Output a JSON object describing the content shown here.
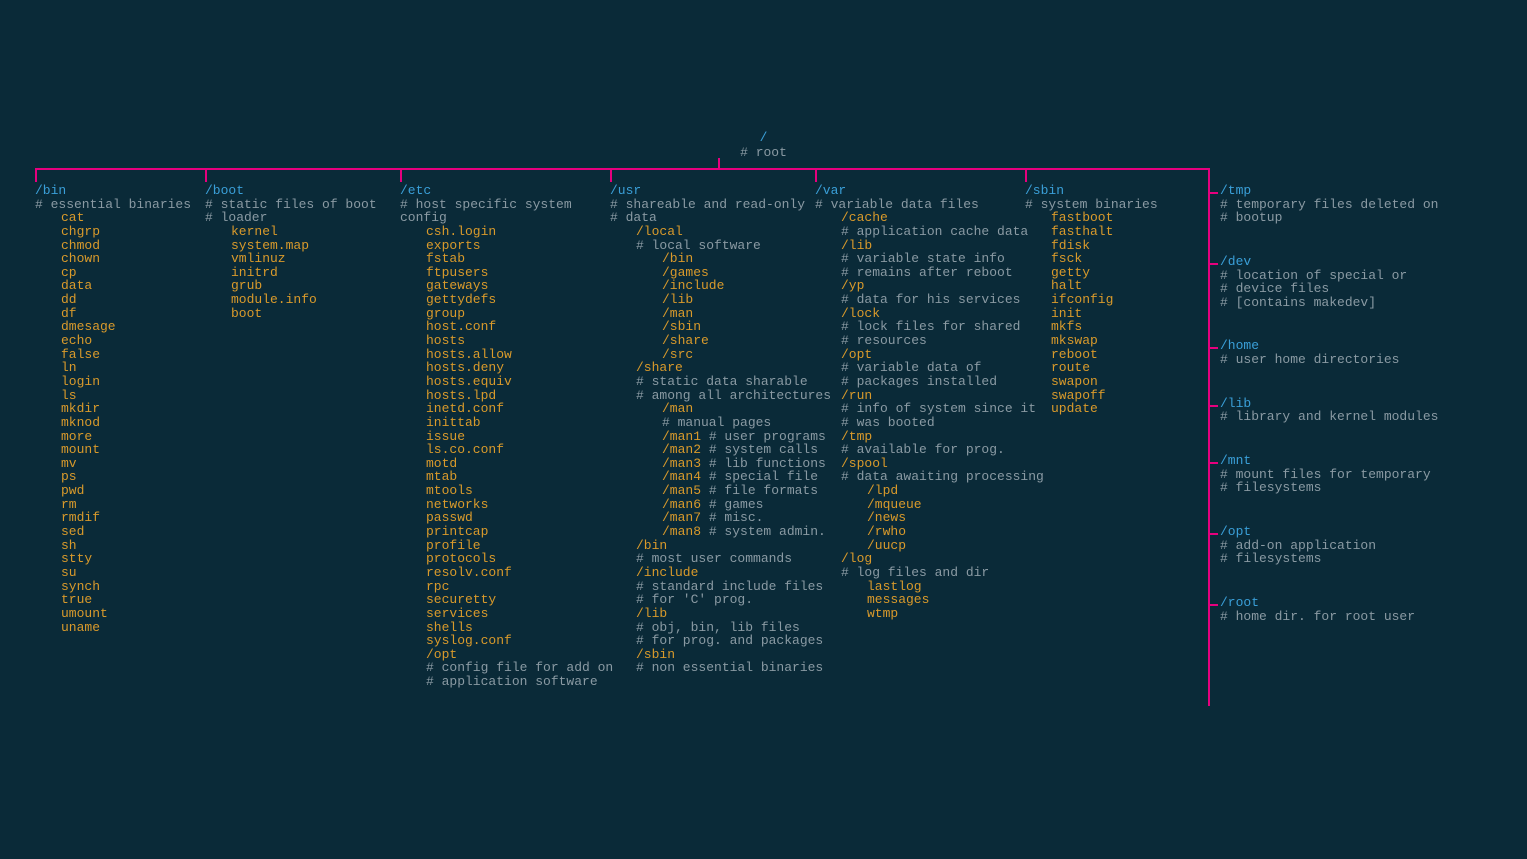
{
  "root": {
    "path": "/",
    "comment": "# root"
  },
  "layout": {
    "hbar_left": 0,
    "hbar_width": 1173,
    "spine_height": 538
  },
  "columns": [
    {
      "cls": "c-bin",
      "header": {
        "path": "/bin",
        "comment": "# essential binaries"
      },
      "lines": [
        {
          "t": "entry",
          "ind": 1,
          "v": "cat"
        },
        {
          "t": "entry",
          "ind": 1,
          "v": "chgrp"
        },
        {
          "t": "entry",
          "ind": 1,
          "v": "chmod"
        },
        {
          "t": "entry",
          "ind": 1,
          "v": "chown"
        },
        {
          "t": "entry",
          "ind": 1,
          "v": "cp"
        },
        {
          "t": "entry",
          "ind": 1,
          "v": "data"
        },
        {
          "t": "entry",
          "ind": 1,
          "v": "dd"
        },
        {
          "t": "entry",
          "ind": 1,
          "v": "df"
        },
        {
          "t": "entry",
          "ind": 1,
          "v": "dmesage"
        },
        {
          "t": "entry",
          "ind": 1,
          "v": "echo"
        },
        {
          "t": "entry",
          "ind": 1,
          "v": "false"
        },
        {
          "t": "entry",
          "ind": 1,
          "v": "ln"
        },
        {
          "t": "entry",
          "ind": 1,
          "v": "login"
        },
        {
          "t": "entry",
          "ind": 1,
          "v": "ls"
        },
        {
          "t": "entry",
          "ind": 1,
          "v": "mkdir"
        },
        {
          "t": "entry",
          "ind": 1,
          "v": "mknod"
        },
        {
          "t": "entry",
          "ind": 1,
          "v": "more"
        },
        {
          "t": "entry",
          "ind": 1,
          "v": "mount"
        },
        {
          "t": "entry",
          "ind": 1,
          "v": "mv"
        },
        {
          "t": "entry",
          "ind": 1,
          "v": "ps"
        },
        {
          "t": "entry",
          "ind": 1,
          "v": "pwd"
        },
        {
          "t": "entry",
          "ind": 1,
          "v": "rm"
        },
        {
          "t": "entry",
          "ind": 1,
          "v": "rmdif"
        },
        {
          "t": "entry",
          "ind": 1,
          "v": "sed"
        },
        {
          "t": "entry",
          "ind": 1,
          "v": "sh"
        },
        {
          "t": "entry",
          "ind": 1,
          "v": "stty"
        },
        {
          "t": "entry",
          "ind": 1,
          "v": "su"
        },
        {
          "t": "entry",
          "ind": 1,
          "v": "synch"
        },
        {
          "t": "entry",
          "ind": 1,
          "v": "true"
        },
        {
          "t": "entry",
          "ind": 1,
          "v": "umount"
        },
        {
          "t": "entry",
          "ind": 1,
          "v": "uname"
        }
      ]
    },
    {
      "cls": "c-boot",
      "header": {
        "path": "/boot",
        "comment": "# static files of boot"
      },
      "lines": [
        {
          "t": "comment",
          "ind": 0,
          "v": "# loader"
        },
        {
          "t": "entry",
          "ind": 1,
          "v": "kernel"
        },
        {
          "t": "entry",
          "ind": 1,
          "v": "system.map"
        },
        {
          "t": "entry",
          "ind": 1,
          "v": "vmlinuz"
        },
        {
          "t": "entry",
          "ind": 1,
          "v": "initrd"
        },
        {
          "t": "entry",
          "ind": 1,
          "v": "grub"
        },
        {
          "t": "entry",
          "ind": 1,
          "v": "module.info"
        },
        {
          "t": "entry",
          "ind": 1,
          "v": "boot"
        }
      ]
    },
    {
      "cls": "c-etc",
      "header": {
        "path": "/etc",
        "comment": "# host specific system config"
      },
      "lines": [
        {
          "t": "entry",
          "ind": 1,
          "v": "csh.login"
        },
        {
          "t": "entry",
          "ind": 1,
          "v": "exports"
        },
        {
          "t": "entry",
          "ind": 1,
          "v": "fstab"
        },
        {
          "t": "entry",
          "ind": 1,
          "v": "ftpusers"
        },
        {
          "t": "entry",
          "ind": 1,
          "v": "gateways"
        },
        {
          "t": "entry",
          "ind": 1,
          "v": "gettydefs"
        },
        {
          "t": "entry",
          "ind": 1,
          "v": "group"
        },
        {
          "t": "entry",
          "ind": 1,
          "v": "host.conf"
        },
        {
          "t": "entry",
          "ind": 1,
          "v": "hosts"
        },
        {
          "t": "entry",
          "ind": 1,
          "v": "hosts.allow"
        },
        {
          "t": "entry",
          "ind": 1,
          "v": "hosts.deny"
        },
        {
          "t": "entry",
          "ind": 1,
          "v": "hosts.equiv"
        },
        {
          "t": "entry",
          "ind": 1,
          "v": "hosts.lpd"
        },
        {
          "t": "entry",
          "ind": 1,
          "v": "inetd.conf"
        },
        {
          "t": "entry",
          "ind": 1,
          "v": "inittab"
        },
        {
          "t": "entry",
          "ind": 1,
          "v": "issue"
        },
        {
          "t": "entry",
          "ind": 1,
          "v": "ls.co.conf"
        },
        {
          "t": "entry",
          "ind": 1,
          "v": "motd"
        },
        {
          "t": "entry",
          "ind": 1,
          "v": "mtab"
        },
        {
          "t": "entry",
          "ind": 1,
          "v": "mtools"
        },
        {
          "t": "entry",
          "ind": 1,
          "v": "networks"
        },
        {
          "t": "entry",
          "ind": 1,
          "v": "passwd"
        },
        {
          "t": "entry",
          "ind": 1,
          "v": "printcap"
        },
        {
          "t": "entry",
          "ind": 1,
          "v": "profile"
        },
        {
          "t": "entry",
          "ind": 1,
          "v": "protocols"
        },
        {
          "t": "entry",
          "ind": 1,
          "v": "resolv.conf"
        },
        {
          "t": "entry",
          "ind": 1,
          "v": "rpc"
        },
        {
          "t": "entry",
          "ind": 1,
          "v": "securetty"
        },
        {
          "t": "entry",
          "ind": 1,
          "v": "services"
        },
        {
          "t": "entry",
          "ind": 1,
          "v": "shells"
        },
        {
          "t": "entry",
          "ind": 1,
          "v": "syslog.conf"
        },
        {
          "t": "subpath",
          "ind": 1,
          "v": "/opt"
        },
        {
          "t": "comment",
          "ind": 1,
          "v": "# config file for add on"
        },
        {
          "t": "comment",
          "ind": 1,
          "v": "# application software"
        }
      ]
    },
    {
      "cls": "c-usr",
      "header": {
        "path": "/usr",
        "comment": "# shareable and read-only"
      },
      "lines": [
        {
          "t": "comment",
          "ind": 0,
          "v": "# data"
        },
        {
          "t": "subpath",
          "ind": 1,
          "v": "/local"
        },
        {
          "t": "comment",
          "ind": 1,
          "v": "# local software"
        },
        {
          "t": "subpath",
          "ind": 2,
          "v": "/bin"
        },
        {
          "t": "subpath",
          "ind": 2,
          "v": "/games"
        },
        {
          "t": "subpath",
          "ind": 2,
          "v": "/include"
        },
        {
          "t": "subpath",
          "ind": 2,
          "v": "/lib"
        },
        {
          "t": "subpath",
          "ind": 2,
          "v": "/man"
        },
        {
          "t": "subpath",
          "ind": 2,
          "v": "/sbin"
        },
        {
          "t": "subpath",
          "ind": 2,
          "v": "/share"
        },
        {
          "t": "subpath",
          "ind": 2,
          "v": "/src"
        },
        {
          "t": "subpath",
          "ind": 1,
          "v": "/share"
        },
        {
          "t": "comment",
          "ind": 1,
          "v": "# static data sharable"
        },
        {
          "t": "comment",
          "ind": 1,
          "v": "# among all architectures"
        },
        {
          "t": "subpath",
          "ind": 2,
          "v": "/man"
        },
        {
          "t": "comment",
          "ind": 2,
          "v": "# manual pages"
        },
        {
          "t": "pair",
          "ind": 2,
          "a": "/man1",
          "b": " # user programs"
        },
        {
          "t": "pair",
          "ind": 2,
          "a": "/man2",
          "b": " # system calls"
        },
        {
          "t": "pair",
          "ind": 2,
          "a": "/man3",
          "b": " # lib functions"
        },
        {
          "t": "pair",
          "ind": 2,
          "a": "/man4",
          "b": " # special file"
        },
        {
          "t": "pair",
          "ind": 2,
          "a": "/man5",
          "b": " # file formats"
        },
        {
          "t": "pair",
          "ind": 2,
          "a": "/man6",
          "b": " # games"
        },
        {
          "t": "pair",
          "ind": 2,
          "a": "/man7",
          "b": " # misc."
        },
        {
          "t": "pair",
          "ind": 2,
          "a": "/man8",
          "b": " # system admin."
        },
        {
          "t": "subpath",
          "ind": 1,
          "v": "/bin"
        },
        {
          "t": "comment",
          "ind": 1,
          "v": "# most user commands"
        },
        {
          "t": "subpath",
          "ind": 1,
          "v": "/include"
        },
        {
          "t": "comment",
          "ind": 1,
          "v": "# standard include files"
        },
        {
          "t": "comment",
          "ind": 1,
          "v": "# for 'C' prog."
        },
        {
          "t": "subpath",
          "ind": 1,
          "v": "/lib"
        },
        {
          "t": "comment",
          "ind": 1,
          "v": "# obj, bin, lib files"
        },
        {
          "t": "comment",
          "ind": 1,
          "v": "# for prog. and packages"
        },
        {
          "t": "subpath",
          "ind": 1,
          "v": "/sbin"
        },
        {
          "t": "comment",
          "ind": 1,
          "v": "# non essential binaries"
        }
      ]
    },
    {
      "cls": "c-var",
      "header": {
        "path": "/var",
        "comment": "# variable data files"
      },
      "lines": [
        {
          "t": "subpath",
          "ind": 1,
          "v": "/cache"
        },
        {
          "t": "comment",
          "ind": 1,
          "v": "# application cache data"
        },
        {
          "t": "subpath",
          "ind": 1,
          "v": "/lib"
        },
        {
          "t": "comment",
          "ind": 1,
          "v": "# variable state info"
        },
        {
          "t": "comment",
          "ind": 1,
          "v": "# remains after reboot"
        },
        {
          "t": "subpath",
          "ind": 1,
          "v": "/yp"
        },
        {
          "t": "comment",
          "ind": 1,
          "v": "# data for his services"
        },
        {
          "t": "subpath",
          "ind": 1,
          "v": "/lock"
        },
        {
          "t": "comment",
          "ind": 1,
          "v": "# lock files for shared"
        },
        {
          "t": "comment",
          "ind": 1,
          "v": "# resources"
        },
        {
          "t": "subpath",
          "ind": 1,
          "v": "/opt"
        },
        {
          "t": "comment",
          "ind": 1,
          "v": "# variable data of"
        },
        {
          "t": "comment",
          "ind": 1,
          "v": "# packages installed"
        },
        {
          "t": "subpath",
          "ind": 1,
          "v": "/run"
        },
        {
          "t": "comment",
          "ind": 1,
          "v": "# info of system since it"
        },
        {
          "t": "comment",
          "ind": 1,
          "v": "# was booted"
        },
        {
          "t": "subpath",
          "ind": 1,
          "v": "/tmp"
        },
        {
          "t": "comment",
          "ind": 1,
          "v": "# available for prog."
        },
        {
          "t": "subpath",
          "ind": 1,
          "v": "/spool"
        },
        {
          "t": "comment",
          "ind": 1,
          "v": "# data awaiting processing"
        },
        {
          "t": "subpath",
          "ind": 2,
          "v": "/lpd"
        },
        {
          "t": "subpath",
          "ind": 2,
          "v": "/mqueue"
        },
        {
          "t": "subpath",
          "ind": 2,
          "v": "/news"
        },
        {
          "t": "subpath",
          "ind": 2,
          "v": "/rwho"
        },
        {
          "t": "subpath",
          "ind": 2,
          "v": "/uucp"
        },
        {
          "t": "subpath",
          "ind": 1,
          "v": "/log"
        },
        {
          "t": "comment",
          "ind": 1,
          "v": "# log files and dir"
        },
        {
          "t": "entry",
          "ind": 2,
          "v": "lastlog"
        },
        {
          "t": "entry",
          "ind": 2,
          "v": "messages"
        },
        {
          "t": "entry",
          "ind": 2,
          "v": "wtmp"
        }
      ]
    },
    {
      "cls": "c-sbin",
      "header": {
        "path": "/sbin",
        "comment": "# system binaries"
      },
      "lines": [
        {
          "t": "entry",
          "ind": 1,
          "v": "fastboot"
        },
        {
          "t": "entry",
          "ind": 1,
          "v": "fasthalt"
        },
        {
          "t": "entry",
          "ind": 1,
          "v": "fdisk"
        },
        {
          "t": "entry",
          "ind": 1,
          "v": "fsck"
        },
        {
          "t": "entry",
          "ind": 1,
          "v": "getty"
        },
        {
          "t": "entry",
          "ind": 1,
          "v": "halt"
        },
        {
          "t": "entry",
          "ind": 1,
          "v": "ifconfig"
        },
        {
          "t": "entry",
          "ind": 1,
          "v": "init"
        },
        {
          "t": "entry",
          "ind": 1,
          "v": "mkfs"
        },
        {
          "t": "entry",
          "ind": 1,
          "v": "mkswap"
        },
        {
          "t": "entry",
          "ind": 1,
          "v": "reboot"
        },
        {
          "t": "entry",
          "ind": 1,
          "v": "route"
        },
        {
          "t": "entry",
          "ind": 1,
          "v": "swapon"
        },
        {
          "t": "entry",
          "ind": 1,
          "v": "swapoff"
        },
        {
          "t": "entry",
          "ind": 1,
          "v": "update"
        }
      ]
    }
  ],
  "right": [
    {
      "path": "/tmp",
      "comments": [
        "# temporary files deleted on",
        "# bootup"
      ]
    },
    {
      "path": "/dev",
      "comments": [
        "# location of special or",
        "# device files",
        "# [contains makedev]"
      ]
    },
    {
      "path": "/home",
      "comments": [
        "# user home directories"
      ]
    },
    {
      "path": "/lib",
      "comments": [
        "# library and kernel modules"
      ]
    },
    {
      "path": "/mnt",
      "comments": [
        "# mount files for temporary",
        "# filesystems"
      ]
    },
    {
      "path": "/opt",
      "comments": [
        "# add-on application",
        "# filesystems"
      ]
    },
    {
      "path": "/root",
      "comments": [
        "# home dir. for root user"
      ]
    }
  ]
}
